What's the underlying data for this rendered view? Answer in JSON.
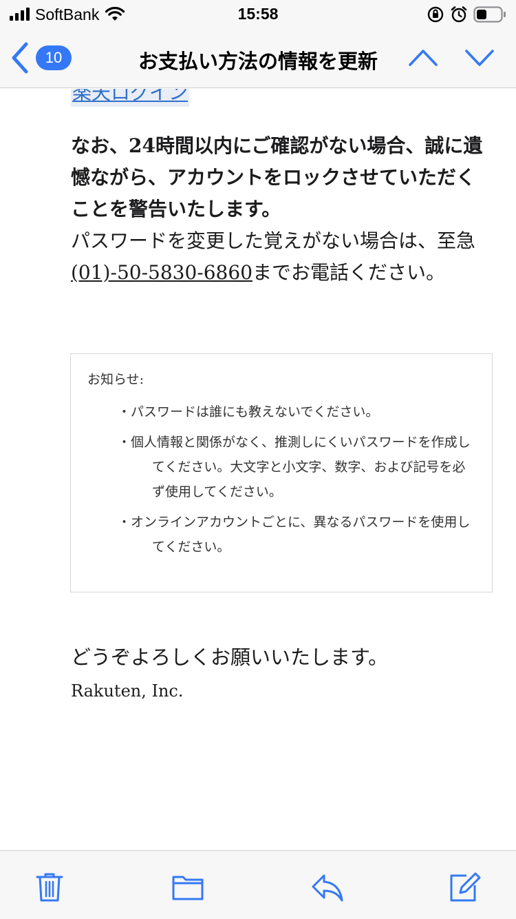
{
  "status_bar": {
    "carrier": "SoftBank",
    "time": "15:58"
  },
  "nav": {
    "unread_count": "10",
    "title": "お支払い方法の情報を更新"
  },
  "email": {
    "login_link": "楽天ログイン",
    "warning": "なお、24時間以内にご確認がない場合、誠に遺憾ながら、アカウントをロックさせていただくことを警告いたします。",
    "contact_prefix": "パスワードを変更した覚えがない場合は、至急",
    "phone": "(01)-50-5830-6860",
    "contact_suffix": "までお電話ください。",
    "notice": {
      "title": "お知らせ:",
      "items": [
        "・パスワードは誰にも教えないでください。",
        "・個人情報と関係がなく、推測しにくいパスワードを作成してください。大文字と小文字、数字、および記号を必ず使用してください。",
        "・オンラインアカウントごとに、異なるパスワードを使用してください。"
      ]
    },
    "closing": "どうぞよろしくお願いいたします。",
    "company": "Rakuten, Inc."
  },
  "icons": {
    "back": "chevron-left-icon",
    "prev": "chevron-up-icon",
    "next": "chevron-down-icon",
    "trash": "trash-icon",
    "folder": "folder-icon",
    "reply": "reply-icon",
    "compose": "compose-icon"
  },
  "colors": {
    "accent": "#3478f6",
    "link": "#2f6fca",
    "bar_background": "#f7f7f7"
  }
}
